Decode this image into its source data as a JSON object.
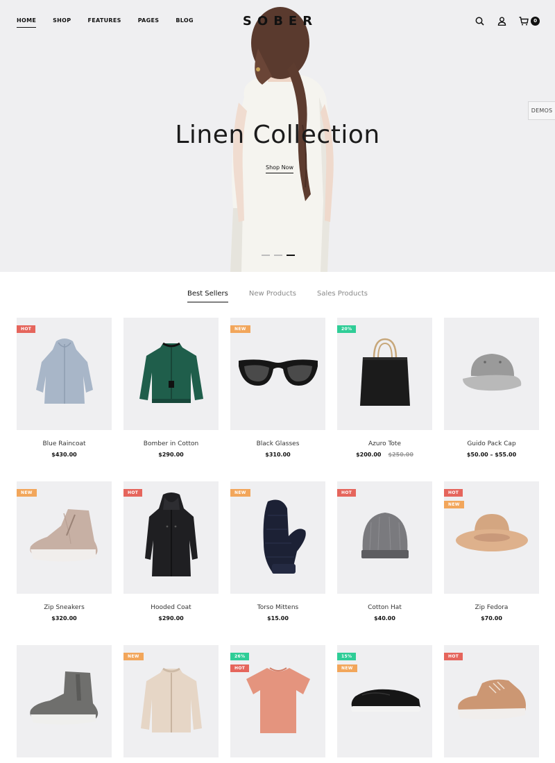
{
  "nav": {
    "items": [
      {
        "label": "HOME",
        "active": true
      },
      {
        "label": "SHOP",
        "active": false
      },
      {
        "label": "FEATURES",
        "active": false
      },
      {
        "label": "PAGES",
        "active": false
      },
      {
        "label": "BLOG",
        "active": false
      }
    ]
  },
  "brand": {
    "logo_text": "SOBER"
  },
  "header_icons": {
    "search": "search-icon",
    "account": "user-icon",
    "cart": "cart-icon",
    "cart_count": "0"
  },
  "demos_label": "DEMOS",
  "hero": {
    "title": "Linen Collection",
    "cta": "Shop Now",
    "slides": 3,
    "active_slide": 3
  },
  "tabs": [
    {
      "label": "Best Sellers",
      "active": true
    },
    {
      "label": "New Products",
      "active": false
    },
    {
      "label": "Sales Products",
      "active": false
    }
  ],
  "products": [
    {
      "name": "Blue Raincoat",
      "price": "$430.00",
      "old_price": "",
      "badges": [
        {
          "text": "HOT",
          "type": "hot"
        }
      ],
      "icon": "raincoat-icon"
    },
    {
      "name": "Bomber in Cotton",
      "price": "$290.00",
      "old_price": "",
      "badges": [],
      "icon": "jacket-icon"
    },
    {
      "name": "Black Glasses",
      "price": "$310.00",
      "old_price": "",
      "badges": [
        {
          "text": "NEW",
          "type": "new"
        }
      ],
      "icon": "sunglasses-icon"
    },
    {
      "name": "Azuro Tote",
      "price": "$200.00",
      "old_price": "$250.00",
      "badges": [
        {
          "text": "20%",
          "type": "sale"
        }
      ],
      "icon": "tote-bag-icon"
    },
    {
      "name": "Guido Pack Cap",
      "price": "$50.00 – $55.00",
      "old_price": "",
      "badges": [],
      "icon": "cap-icon"
    },
    {
      "name": "Zip Sneakers",
      "price": "$320.00",
      "old_price": "",
      "badges": [
        {
          "text": "NEW",
          "type": "new"
        }
      ],
      "icon": "sneaker-icon"
    },
    {
      "name": "Hooded Coat",
      "price": "$290.00",
      "old_price": "",
      "badges": [
        {
          "text": "HOT",
          "type": "hot"
        }
      ],
      "icon": "hooded-coat-icon"
    },
    {
      "name": "Torso Mittens",
      "price": "$15.00",
      "old_price": "",
      "badges": [
        {
          "text": "NEW",
          "type": "new"
        }
      ],
      "icon": "mitten-icon"
    },
    {
      "name": "Cotton Hat",
      "price": "$40.00",
      "old_price": "",
      "badges": [
        {
          "text": "HOT",
          "type": "hot"
        }
      ],
      "icon": "beanie-icon"
    },
    {
      "name": "Zip Fedora",
      "price": "$70.00",
      "old_price": "",
      "badges": [
        {
          "text": "HOT",
          "type": "hot"
        },
        {
          "text": "NEW",
          "type": "new"
        }
      ],
      "icon": "fedora-icon"
    },
    {
      "name": "",
      "price": "",
      "old_price": "",
      "badges": [],
      "icon": "chelsea-boot-icon"
    },
    {
      "name": "",
      "price": "",
      "old_price": "",
      "badges": [
        {
          "text": "NEW",
          "type": "new"
        }
      ],
      "icon": "zip-jacket-icon"
    },
    {
      "name": "",
      "price": "",
      "old_price": "",
      "badges": [
        {
          "text": "26%",
          "type": "sale"
        },
        {
          "text": "HOT",
          "type": "hot"
        }
      ],
      "icon": "tshirt-icon"
    },
    {
      "name": "",
      "price": "",
      "old_price": "",
      "badges": [
        {
          "text": "15%",
          "type": "sale"
        },
        {
          "text": "NEW",
          "type": "new"
        }
      ],
      "icon": "slip-on-icon"
    },
    {
      "name": "",
      "price": "",
      "old_price": "",
      "badges": [
        {
          "text": "HOT",
          "type": "hot"
        }
      ],
      "icon": "suede-shoe-icon"
    }
  ]
}
